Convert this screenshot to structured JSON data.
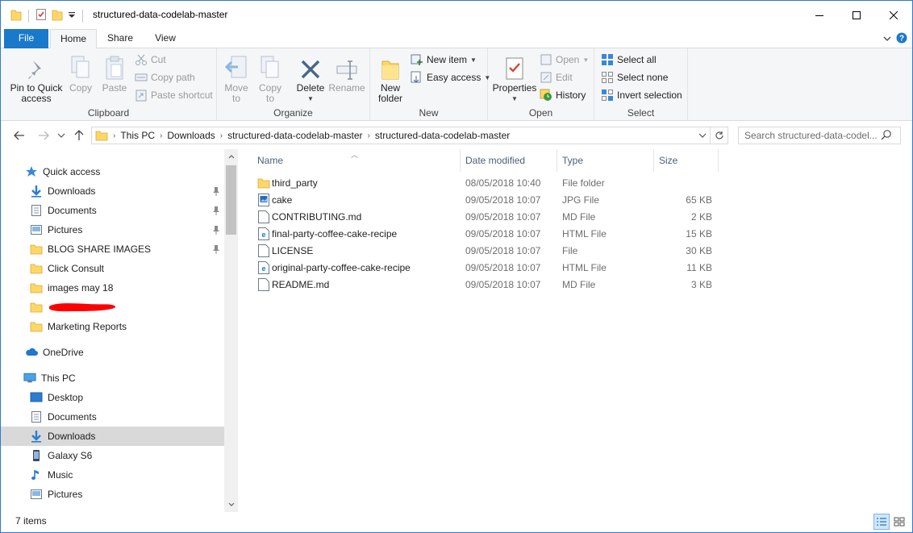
{
  "window": {
    "title": "structured-data-codelab-master"
  },
  "ribbon_tabs": [
    {
      "label": "File"
    },
    {
      "label": "Home"
    },
    {
      "label": "Share"
    },
    {
      "label": "View"
    }
  ],
  "ribbon": {
    "clipboard": {
      "label": "Clipboard",
      "pin": "Pin to Quick\naccess",
      "copy": "Copy",
      "paste": "Paste",
      "cut": "Cut",
      "copy_path": "Copy path",
      "paste_shortcut": "Paste shortcut"
    },
    "organize": {
      "label": "Organize",
      "move_to": "Move\nto",
      "copy_to": "Copy\nto",
      "delete": "Delete",
      "rename": "Rename"
    },
    "new": {
      "label": "New",
      "new_folder": "New\nfolder",
      "new_item": "New item",
      "easy_access": "Easy access"
    },
    "open": {
      "label": "Open",
      "properties": "Properties",
      "open": "Open",
      "edit": "Edit",
      "history": "History"
    },
    "select": {
      "label": "Select",
      "select_all": "Select all",
      "select_none": "Select none",
      "invert_selection": "Invert selection"
    }
  },
  "address": {
    "crumbs": [
      "This PC",
      "Downloads",
      "structured-data-codelab-master",
      "structured-data-codelab-master"
    ],
    "search_placeholder": "Search structured-data-codel..."
  },
  "nav_pane": {
    "quick_access": "Quick access",
    "quick_items": [
      "Downloads",
      "Documents",
      "Pictures",
      "BLOG SHARE IMAGES",
      "Click Consult",
      "images may 18",
      "",
      "Marketing Reports"
    ],
    "onedrive": "OneDrive",
    "this_pc": "This PC",
    "pc_items": [
      "Desktop",
      "Documents",
      "Downloads",
      "Galaxy S6",
      "Music",
      "Pictures"
    ]
  },
  "columns": {
    "name": "Name",
    "date": "Date modified",
    "type": "Type",
    "size": "Size"
  },
  "files": [
    {
      "name": "third_party",
      "date": "08/05/2018 10:40",
      "type": "File folder",
      "size": "",
      "icon": "folder-icon"
    },
    {
      "name": "cake",
      "date": "09/05/2018 10:07",
      "type": "JPG File",
      "size": "65 KB",
      "icon": "image-file-icon"
    },
    {
      "name": "CONTRIBUTING.md",
      "date": "09/05/2018 10:07",
      "type": "MD File",
      "size": "2 KB",
      "icon": "document-icon"
    },
    {
      "name": "final-party-coffee-cake-recipe",
      "date": "09/05/2018 10:07",
      "type": "HTML File",
      "size": "15 KB",
      "icon": "edge-html-icon"
    },
    {
      "name": "LICENSE",
      "date": "09/05/2018 10:07",
      "type": "File",
      "size": "30 KB",
      "icon": "document-icon"
    },
    {
      "name": "original-party-coffee-cake-recipe",
      "date": "09/05/2018 10:07",
      "type": "HTML File",
      "size": "11 KB",
      "icon": "edge-html-icon"
    },
    {
      "name": "README.md",
      "date": "09/05/2018 10:07",
      "type": "MD File",
      "size": "3 KB",
      "icon": "document-icon"
    }
  ],
  "status": {
    "items": "7 items"
  },
  "colors": {
    "accent": "#1979ca",
    "folder": "#ffd767",
    "selection": "#d9d9d9",
    "redaction": "#ff0000"
  }
}
